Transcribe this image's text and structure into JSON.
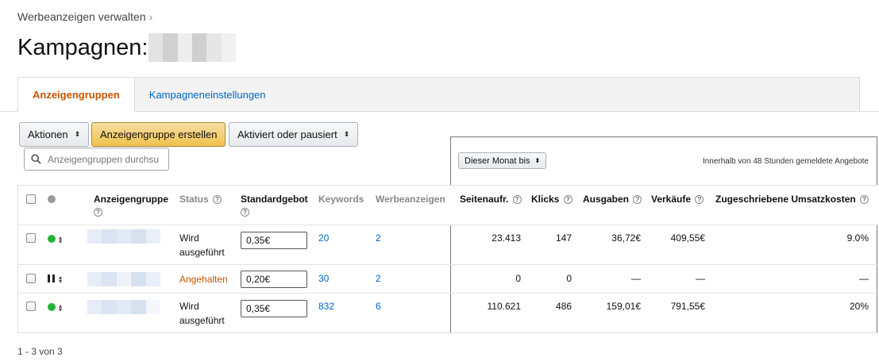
{
  "breadcrumb": {
    "label": "Werbeanzeigen verwalten",
    "separator": "›"
  },
  "page": {
    "title": "Kampagnen:"
  },
  "tabs": [
    {
      "label": "Anzeigengruppen",
      "active": true
    },
    {
      "label": "Kampagneneinstellungen",
      "active": false
    }
  ],
  "toolbar": {
    "actions_label": "Aktionen",
    "create_label": "Anzeigengruppe erstellen",
    "filter_label": "Aktiviert oder pausiert",
    "caret": "⬍"
  },
  "search": {
    "placeholder": "Anzeigengruppen durchsu"
  },
  "metrics": {
    "date_range": "Dieser Monat bis",
    "note": "Innerhalb von 48 Stunden gemeldete Angebote"
  },
  "table": {
    "columns": {
      "adgroup": "Anzeigengruppe",
      "status": "Status",
      "bid": "Standardgebot",
      "keywords": "Keywords",
      "ads": "Werbeanzeigen",
      "impressions": "Seitenaufr.",
      "clicks": "Klicks",
      "spend": "Ausgaben",
      "sales": "Verkäufe",
      "acos": "Zugeschriebene Umsatzkosten"
    },
    "help_glyph": "?",
    "rows": [
      {
        "status_line1": "Wird",
        "status_line2": "ausgeführt",
        "state": "active",
        "bid": "0,35€",
        "keywords": "20",
        "ads": "2",
        "impressions": "23.413",
        "clicks": "147",
        "spend": "36,72€",
        "sales": "409,55€",
        "acos": "9.0%"
      },
      {
        "status_line1": "Angehalten",
        "status_line2": "",
        "state": "paused",
        "bid": "0,20€",
        "keywords": "30",
        "ads": "2",
        "impressions": "0",
        "clicks": "0",
        "spend": "—",
        "sales": "—",
        "acos": "—"
      },
      {
        "status_line1": "Wird",
        "status_line2": "ausgeführt",
        "state": "active",
        "bid": "0,35€",
        "keywords": "832",
        "ads": "6",
        "impressions": "110.621",
        "clicks": "486",
        "spend": "159,01€",
        "sales": "791,55€",
        "acos": "20%"
      }
    ]
  },
  "pagination": {
    "label": "1 - 3 von 3"
  },
  "colors": {
    "accent_orange": "#c45500",
    "link_blue": "#0066c0",
    "active_green": "#22b532",
    "primary_button": "#f0c14b"
  },
  "icons": {
    "search": "search-icon",
    "help": "help-icon",
    "status_active": "green-dot-icon",
    "status_paused": "pause-icon",
    "sort": "sort-arrows-icon"
  }
}
